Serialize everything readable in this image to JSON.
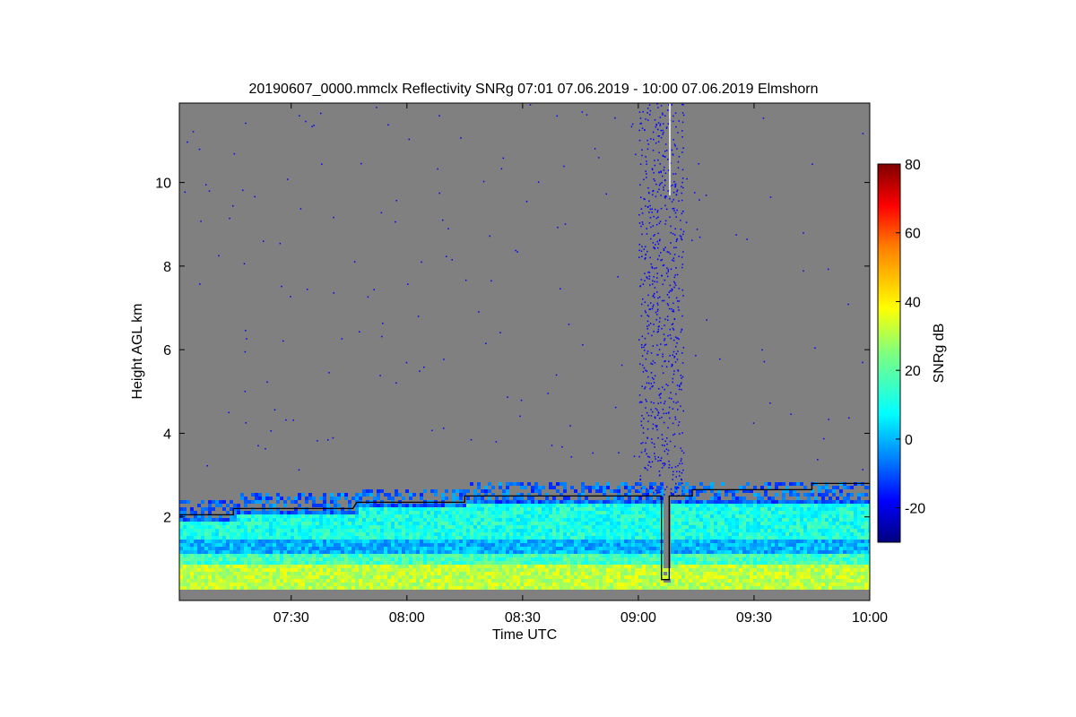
{
  "chart_data": {
    "type": "heatmap",
    "title": "20190607_0000.mmclx Reflectivity SNRg   07:01 07.06.2019 - 10:00 07.06.2019 Elmshorn",
    "xlabel": "Time UTC",
    "ylabel": "Height AGL km",
    "colorbar_label": "SNRg dB",
    "x_range": [
      "07:01",
      "10:00"
    ],
    "y_range_km": [
      0.0,
      11.9
    ],
    "x_ticks": [
      "07:30",
      "08:00",
      "08:30",
      "09:00",
      "09:30",
      "10:00"
    ],
    "y_ticks": [
      2,
      4,
      6,
      8,
      10
    ],
    "colorbar_range": [
      -30,
      80
    ],
    "colorbar_ticks": [
      -20,
      0,
      20,
      40,
      60,
      80
    ],
    "colormap": "jet",
    "background_color": "#808080",
    "boundary_layer_top_km": [
      {
        "time": "07:01",
        "height": 2.05
      },
      {
        "time": "07:15",
        "height": 2.05
      },
      {
        "time": "07:15",
        "height": 2.2
      },
      {
        "time": "07:46",
        "height": 2.2
      },
      {
        "time": "07:47",
        "height": 2.35
      },
      {
        "time": "08:15",
        "height": 2.35
      },
      {
        "time": "08:15",
        "height": 2.5
      },
      {
        "time": "09:06",
        "height": 2.5
      },
      {
        "time": "09:06",
        "height": 0.5
      },
      {
        "time": "09:08",
        "height": 0.5
      },
      {
        "time": "09:08",
        "height": 2.5
      },
      {
        "time": "09:14",
        "height": 2.5
      },
      {
        "time": "09:14",
        "height": 2.65
      },
      {
        "time": "09:45",
        "height": 2.65
      },
      {
        "time": "09:45",
        "height": 2.8
      },
      {
        "time": "10:00",
        "height": 2.8
      }
    ]
  }
}
